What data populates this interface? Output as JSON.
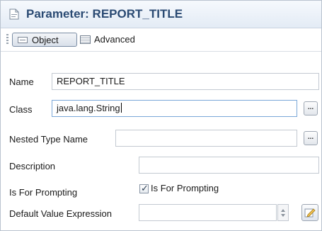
{
  "header": {
    "title": "Parameter: REPORT_TITLE",
    "icon": "parameter-icon"
  },
  "toolbar": {
    "tabs": [
      {
        "label": "Object",
        "icon": "object-icon",
        "selected": true
      },
      {
        "label": "Advanced",
        "icon": "table-icon",
        "selected": false
      }
    ]
  },
  "form": {
    "name": {
      "label": "Name",
      "value": "REPORT_TITLE"
    },
    "class": {
      "label": "Class",
      "value": "java.lang.String",
      "button_label": "..."
    },
    "nested_type_name": {
      "label": "Nested Type Name",
      "value": "",
      "button_label": "..."
    },
    "description": {
      "label": "Description",
      "value": ""
    },
    "is_for_prompting": {
      "label": "Is For Prompting",
      "checkbox_label": "Is For Prompting",
      "checked": true
    },
    "default_value_expression": {
      "label": "Default Value Expression",
      "value": ""
    }
  }
}
